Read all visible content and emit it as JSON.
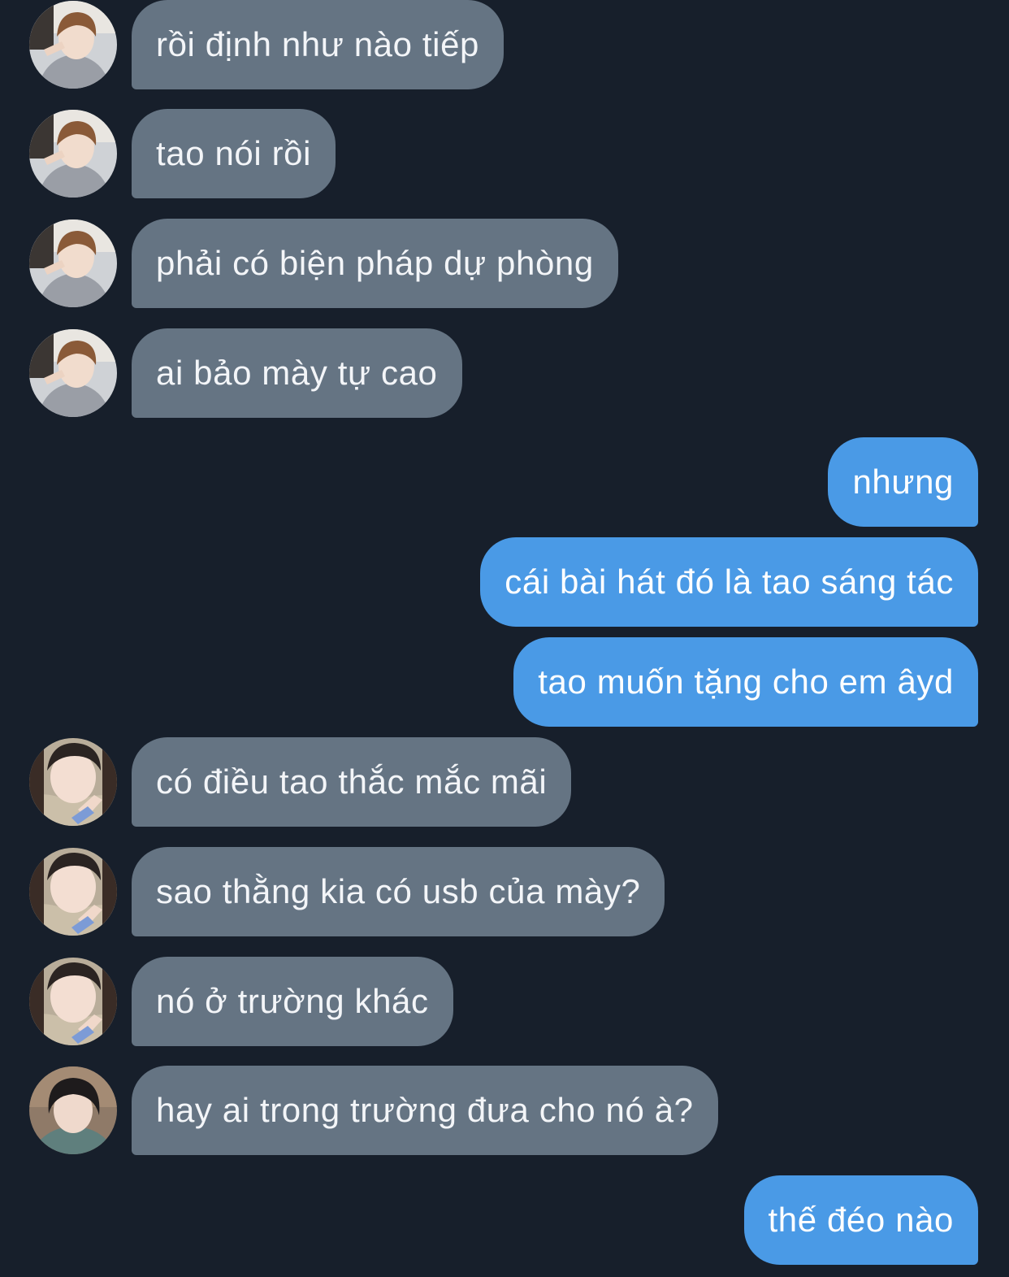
{
  "chat": {
    "colors": {
      "background": "#171f2b",
      "incoming_bubble": "#657483",
      "outgoing_bubble": "#4a9ae6",
      "text": "#ffffff"
    },
    "messages": [
      {
        "sender": "other",
        "avatar": "avatar-1",
        "text": "rồi định như nào tiếp"
      },
      {
        "sender": "other",
        "avatar": "avatar-1",
        "text": "tao nói rồi"
      },
      {
        "sender": "other",
        "avatar": "avatar-1",
        "text": "phải có biện pháp dự phòng"
      },
      {
        "sender": "other",
        "avatar": "avatar-1",
        "text": "ai bảo mày tự cao"
      },
      {
        "sender": "me",
        "text": "nhưng"
      },
      {
        "sender": "me",
        "text": "cái bài hát đó là tao sáng tác"
      },
      {
        "sender": "me",
        "text": "tao muốn tặng cho em âyd"
      },
      {
        "sender": "other",
        "avatar": "avatar-2",
        "text": "có điều tao thắc mắc mãi"
      },
      {
        "sender": "other",
        "avatar": "avatar-2",
        "text": "sao thằng kia có usb của mày?"
      },
      {
        "sender": "other",
        "avatar": "avatar-2",
        "text": "nó ở trường khác"
      },
      {
        "sender": "other",
        "avatar": "avatar-3",
        "text": "hay ai trong trường đưa cho nó à?"
      },
      {
        "sender": "me",
        "text": "thế đéo nào"
      }
    ]
  }
}
